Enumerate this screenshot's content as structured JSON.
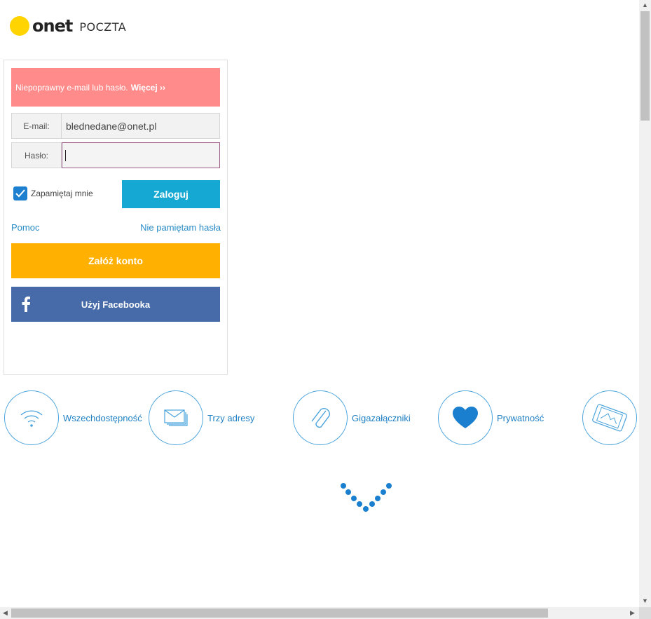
{
  "brand": {
    "logo_text": "onet",
    "product": "POCZTA"
  },
  "alert": {
    "message": "Niepoprawny e-mail lub hasło.",
    "more_link": "Więcej ››"
  },
  "form": {
    "email_label": "E-mail:",
    "email_value": "blednedane@onet.pl",
    "password_label": "Hasło:",
    "password_value": "",
    "remember_label": "Zapamiętaj mnie",
    "remember_checked": true,
    "login_button": "Zaloguj"
  },
  "links": {
    "help": "Pomoc",
    "forgot_password": "Nie pamiętam hasła"
  },
  "buttons": {
    "create_account": "Załóż konto",
    "facebook": "Użyj Facebooka"
  },
  "features": [
    {
      "label": "Wszechdostępność",
      "icon": "wifi-icon"
    },
    {
      "label": "Trzy adresy",
      "icon": "envelopes-icon"
    },
    {
      "label": "Gigazałączniki",
      "icon": "paperclip-icon"
    },
    {
      "label": "Prywatność",
      "icon": "heart-icon"
    },
    {
      "label": "",
      "icon": "phone-icon"
    }
  ],
  "colors": {
    "logo_dot": "#ffd400",
    "alert_bg": "#ff8b8b",
    "login_button": "#15a8d2",
    "create_button": "#ffb000",
    "facebook_button": "#476aa8",
    "link": "#2a8cc7",
    "feature_accent": "#1f80c4"
  }
}
